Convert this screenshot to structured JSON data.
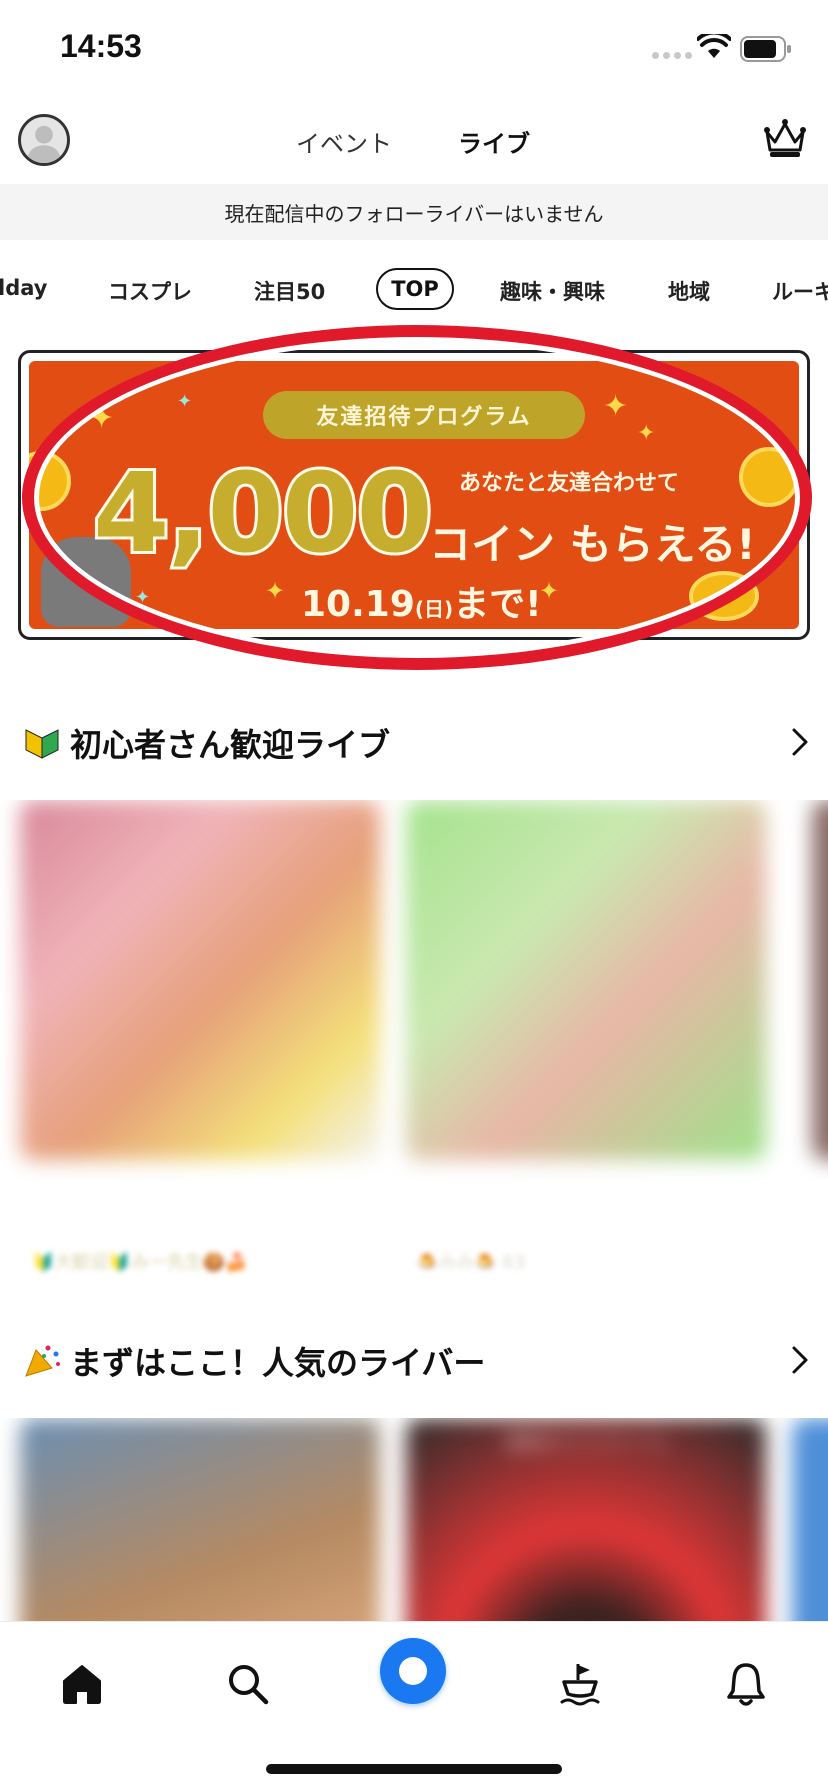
{
  "status_bar": {
    "time": "14:53"
  },
  "header": {
    "tabs": [
      {
        "label": "イベント"
      },
      {
        "label": "ライブ"
      }
    ]
  },
  "notice": {
    "text": "現在配信中のフォローライバーはいません"
  },
  "categories": [
    "lday",
    "コスプレ",
    "注目50",
    "TOP",
    "趣味・興味",
    "地域",
    "ルーキ"
  ],
  "banner": {
    "pill": "友達招待プログラム",
    "amount": "4,000",
    "subtitle": "あなたと友達合わせて",
    "coin_text": "コイン もらえる!",
    "date_main": "10.19",
    "date_day": "(日)",
    "date_suffix": "まで!"
  },
  "sections": [
    {
      "title": "初心者さん歓迎ライブ",
      "emoji": "beginner-mark-icon",
      "meta": [
        "🔰大歓迎🔰みー先生🍪🍰",
        "🍮みみ🍮 63"
      ]
    },
    {
      "title": "まずはここ！人気のライバー",
      "emoji": "party-popper-icon",
      "overlay": "最高のファミリーと"
    }
  ],
  "colors": {
    "accent": "#1a78f0",
    "banner_bg": "#e24d14",
    "highlight": "#e01a2b"
  },
  "tab_bar": {
    "items": [
      "home-icon",
      "search-icon",
      "go-live-button",
      "ship-icon",
      "bell-icon"
    ]
  }
}
